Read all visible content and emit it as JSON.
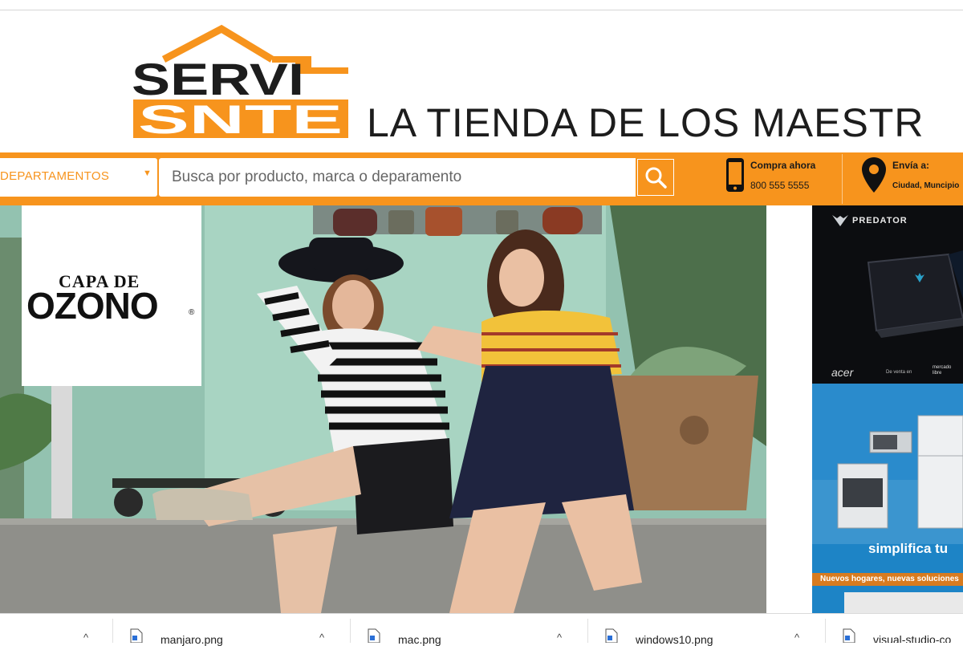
{
  "header": {
    "logo_top": "SERVI",
    "logo_bottom": "SNTE",
    "tagline": "LA TIENDA DE LOS MAESTR"
  },
  "nav": {
    "departments_label": "DEPARTAMENTOS",
    "search_placeholder": "Busca por producto, marca o deparamento",
    "buy_label": "Compra ahora",
    "buy_phone": "800 555 5555",
    "ship_label": "Envía a:",
    "ship_value": "Ciudad, Muncipio"
  },
  "banner": {
    "brand_small": "CAPA DE",
    "brand_large": "OZONO",
    "brand_mark": "®"
  },
  "side_ads": {
    "ad1_brand": "PREDATOR",
    "ad1_maker": "acer",
    "ad1_small": "De venta en",
    "ad1_partner": "mercado libre",
    "ad2_text": "simplifica tu",
    "ad2_tag": "Nuevos hogares, nuevas soluciones"
  },
  "downloads": [
    {
      "name": "manjaro.png"
    },
    {
      "name": "mac.png"
    },
    {
      "name": "windows10.png"
    },
    {
      "name": "visual-studio-co"
    }
  ],
  "colors": {
    "brand_orange": "#f7941d",
    "dark": "#1d1d1d"
  }
}
